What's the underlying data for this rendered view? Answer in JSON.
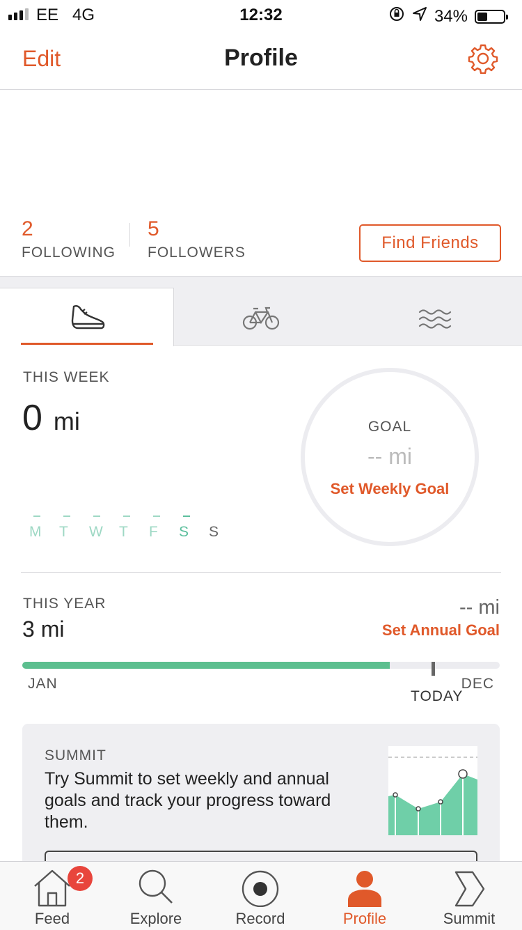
{
  "status": {
    "carrier": "EE",
    "network": "4G",
    "time": "12:32",
    "battery": "34%"
  },
  "nav": {
    "edit": "Edit",
    "title": "Profile"
  },
  "social": {
    "following_count": "2",
    "following_label": "FOLLOWING",
    "followers_count": "5",
    "followers_label": "FOLLOWERS",
    "find_friends": "Find Friends"
  },
  "week": {
    "caption": "THIS WEEK",
    "value": "0",
    "unit": "mi",
    "days": [
      "M",
      "T",
      "W",
      "T",
      "F",
      "S",
      "S"
    ]
  },
  "goal": {
    "label": "GOAL",
    "value": "-- mi",
    "action": "Set Weekly Goal"
  },
  "year": {
    "caption": "THIS YEAR",
    "value": "3 mi",
    "goal_value": "-- mi",
    "action": "Set Annual Goal",
    "start": "JAN",
    "end": "DEC",
    "today": "TODAY",
    "progress_fraction": 0.77
  },
  "summit": {
    "caption": "SUMMIT",
    "text": "Try Summit to set weekly and annual goals and track your progress toward them."
  },
  "tabbar": {
    "feed": "Feed",
    "feed_badge": "2",
    "explore": "Explore",
    "record": "Record",
    "profile": "Profile",
    "summit": "Summit"
  },
  "colors": {
    "accent": "#e0592a",
    "green": "#5cbf8f",
    "badge": "#e8453c"
  }
}
